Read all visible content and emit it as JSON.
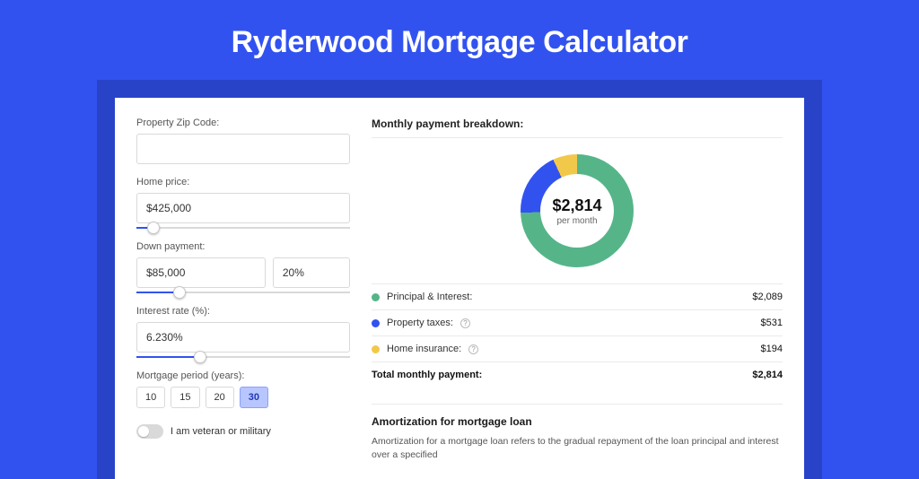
{
  "title": "Ryderwood Mortgage Calculator",
  "form": {
    "zip": {
      "label": "Property Zip Code:",
      "value": ""
    },
    "home_price": {
      "label": "Home price:",
      "value": "$425,000",
      "slider_pct": 8
    },
    "down_payment": {
      "label": "Down payment:",
      "amount": "$85,000",
      "percent": "20%",
      "slider_pct": 20
    },
    "interest_rate": {
      "label": "Interest rate (%):",
      "value": "6.230%",
      "slider_pct": 30
    },
    "period": {
      "label": "Mortgage period (years):",
      "options": [
        "10",
        "15",
        "20",
        "30"
      ],
      "selected": "30"
    },
    "veteran": {
      "label": "I am veteran or military"
    }
  },
  "breakdown": {
    "title": "Monthly payment breakdown:",
    "center_amount": "$2,814",
    "center_sub": "per month",
    "items": [
      {
        "label": "Principal & Interest:",
        "value": "$2,089",
        "color": "#55b589",
        "info": false
      },
      {
        "label": "Property taxes:",
        "value": "$531",
        "color": "#3252f0",
        "info": true
      },
      {
        "label": "Home insurance:",
        "value": "$194",
        "color": "#f2c84b",
        "info": true
      }
    ],
    "total_label": "Total monthly payment:",
    "total_value": "$2,814"
  },
  "amortization": {
    "title": "Amortization for mortgage loan",
    "body": "Amortization for a mortgage loan refers to the gradual repayment of the loan principal and interest over a specified"
  },
  "chart_data": {
    "type": "pie",
    "title": "Monthly payment breakdown",
    "series": [
      {
        "name": "Principal & Interest",
        "value": 2089,
        "color": "#55b589"
      },
      {
        "name": "Property taxes",
        "value": 531,
        "color": "#3252f0"
      },
      {
        "name": "Home insurance",
        "value": 194,
        "color": "#f2c84b"
      }
    ],
    "total": 2814,
    "unit": "USD per month"
  }
}
